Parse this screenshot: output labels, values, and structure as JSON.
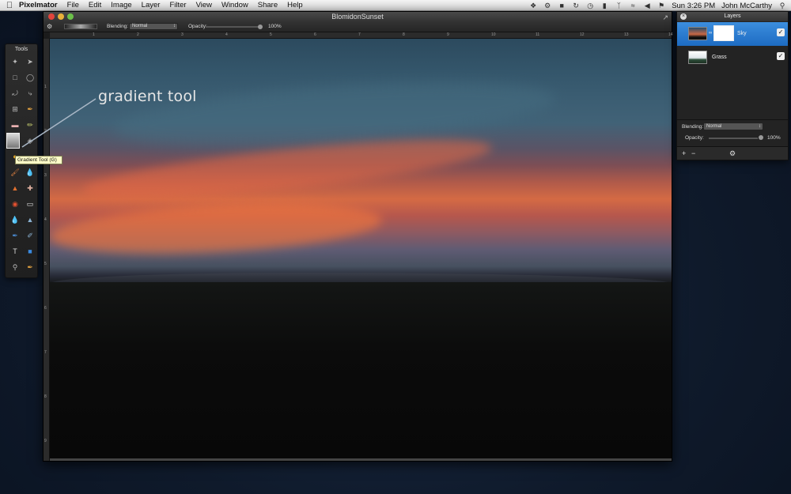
{
  "menubar": {
    "app_name": "Pixelmator",
    "items": [
      "File",
      "Edit",
      "Image",
      "Layer",
      "Filter",
      "View",
      "Window",
      "Share",
      "Help"
    ],
    "clock": "Sun 3:26 PM",
    "user": "John McCarthy"
  },
  "document": {
    "title": "BlomidonSunset",
    "options": {
      "blending_label": "Blending:",
      "blending_value": "Normal",
      "opacity_label": "Opacity:",
      "opacity_value": "100%",
      "opacity_fraction": 1.0
    },
    "ruler_top": [
      "1",
      "2",
      "3",
      "4",
      "5",
      "6",
      "7",
      "8",
      "9",
      "10",
      "11",
      "12",
      "13",
      "14"
    ],
    "ruler_left": [
      "1",
      "2",
      "3",
      "4",
      "5",
      "6",
      "7",
      "8",
      "9"
    ]
  },
  "tools": {
    "title": "Tools",
    "active_tool": "gradient-tool",
    "tooltip": "Gradient Tool (G)"
  },
  "annotation": {
    "text": "gradient tool"
  },
  "layers": {
    "title": "Layers",
    "items": [
      {
        "name": "Sky",
        "visible": true,
        "selected": true
      },
      {
        "name": "Grass",
        "visible": true,
        "selected": false
      }
    ],
    "blending_label": "Blending:",
    "blending_value": "Normal",
    "opacity_label": "Opacity:",
    "opacity_value": "100%",
    "opacity_fraction": 1.0
  },
  "colors": {
    "selection_blue": "#2a7ad2",
    "tooltip_yellow": "#fffdc8"
  }
}
